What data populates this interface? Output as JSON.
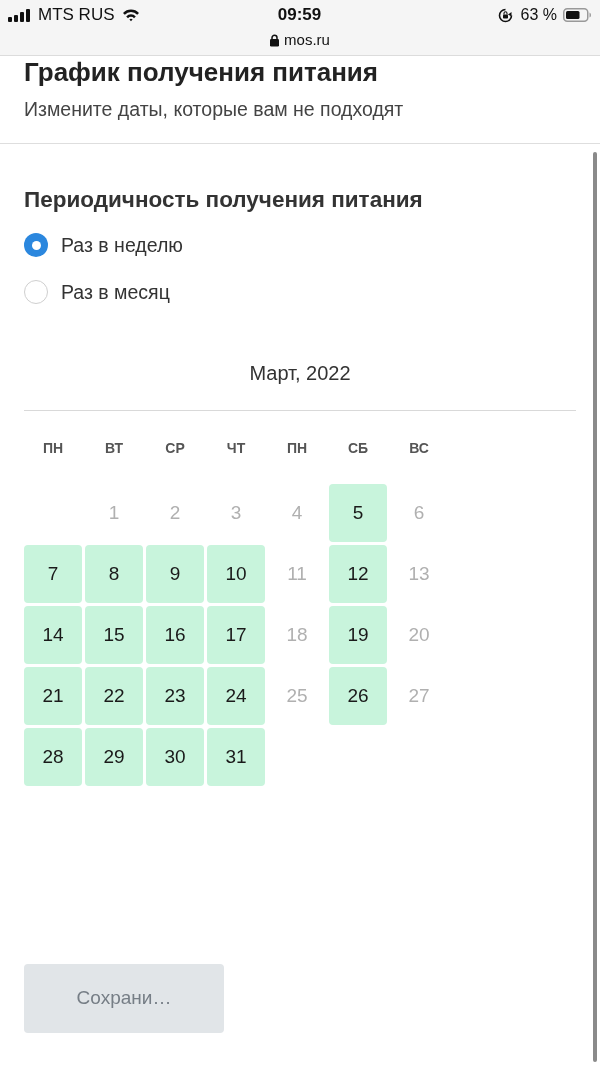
{
  "status_bar": {
    "carrier": "MTS RUS",
    "time": "09:59",
    "url": "mos.ru",
    "battery": "63 %"
  },
  "header": {
    "title": "График получения питания",
    "subtitle": "Измените даты, которые вам не подходят"
  },
  "frequency": {
    "title": "Периодичность получения питания",
    "options": [
      {
        "label": "Раз в неделю",
        "selected": true
      },
      {
        "label": "Раз в месяц",
        "selected": false
      }
    ]
  },
  "calendar": {
    "month": "Март, 2022",
    "weekdays": [
      "ПН",
      "ВТ",
      "СР",
      "ЧТ",
      "ПН",
      "СБ",
      "ВС"
    ],
    "weeks": [
      [
        {
          "kind": "blank"
        },
        {
          "kind": "day",
          "label": "1",
          "selected": false
        },
        {
          "kind": "day",
          "label": "2",
          "selected": false
        },
        {
          "kind": "day",
          "label": "3",
          "selected": false
        },
        {
          "kind": "day",
          "label": "4",
          "selected": false
        },
        {
          "kind": "day",
          "label": "5",
          "selected": true
        },
        {
          "kind": "day",
          "label": "6",
          "selected": false
        }
      ],
      [
        {
          "kind": "day",
          "label": "7",
          "selected": true
        },
        {
          "kind": "day",
          "label": "8",
          "selected": true
        },
        {
          "kind": "day",
          "label": "9",
          "selected": true
        },
        {
          "kind": "day",
          "label": "10",
          "selected": true
        },
        {
          "kind": "day",
          "label": "11",
          "selected": false
        },
        {
          "kind": "day",
          "label": "12",
          "selected": true
        },
        {
          "kind": "day",
          "label": "13",
          "selected": false
        }
      ],
      [
        {
          "kind": "day",
          "label": "14",
          "selected": true
        },
        {
          "kind": "day",
          "label": "15",
          "selected": true
        },
        {
          "kind": "day",
          "label": "16",
          "selected": true
        },
        {
          "kind": "day",
          "label": "17",
          "selected": true
        },
        {
          "kind": "day",
          "label": "18",
          "selected": false
        },
        {
          "kind": "day",
          "label": "19",
          "selected": true
        },
        {
          "kind": "day",
          "label": "20",
          "selected": false
        }
      ],
      [
        {
          "kind": "day",
          "label": "21",
          "selected": true
        },
        {
          "kind": "day",
          "label": "22",
          "selected": true
        },
        {
          "kind": "day",
          "label": "23",
          "selected": true
        },
        {
          "kind": "day",
          "label": "24",
          "selected": true
        },
        {
          "kind": "day",
          "label": "25",
          "selected": false
        },
        {
          "kind": "day",
          "label": "26",
          "selected": true
        },
        {
          "kind": "day",
          "label": "27",
          "selected": false
        }
      ],
      [
        {
          "kind": "day",
          "label": "28",
          "selected": true
        },
        {
          "kind": "day",
          "label": "29",
          "selected": true
        },
        {
          "kind": "day",
          "label": "30",
          "selected": true
        },
        {
          "kind": "day",
          "label": "31",
          "selected": true
        }
      ]
    ]
  },
  "save_button": {
    "label": "Сохрани…",
    "disabled": true
  }
}
